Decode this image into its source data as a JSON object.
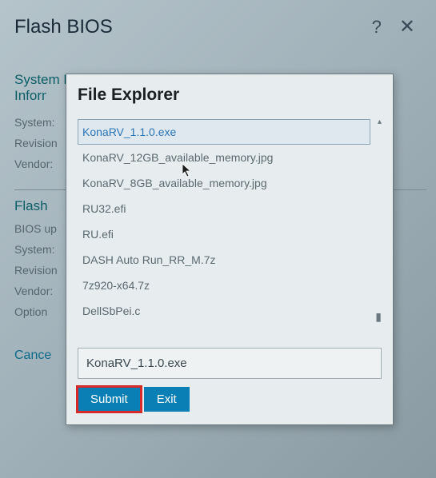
{
  "colors": {
    "accent": "#0a7fb5",
    "highlight": "#d62a2a",
    "link": "#2a74b8"
  },
  "bg": {
    "title": "Flash BIOS",
    "section1": "System BIOS",
    "section1b": "Information",
    "labels": [
      "System:",
      "Revision",
      "Vendor:"
    ],
    "section2": "Flash",
    "labels2": [
      "BIOS up",
      "System:",
      "Revision",
      "Vendor:",
      "Option"
    ],
    "cancel": "Cance"
  },
  "dialog": {
    "title": "File Explorer",
    "files": [
      "KonaRV_1.1.0.exe",
      "KonaRV_12GB_available_memory.jpg",
      "KonaRV_8GB_available_memory.jpg",
      "RU32.efi",
      "RU.efi",
      "DASH Auto Run_RR_M.7z",
      "7z920-x64.7z",
      "DellSbPei.c"
    ],
    "selectedIndex": 0,
    "filename": "KonaRV_1.1.0.exe",
    "submit": "Submit",
    "exit": "Exit"
  }
}
